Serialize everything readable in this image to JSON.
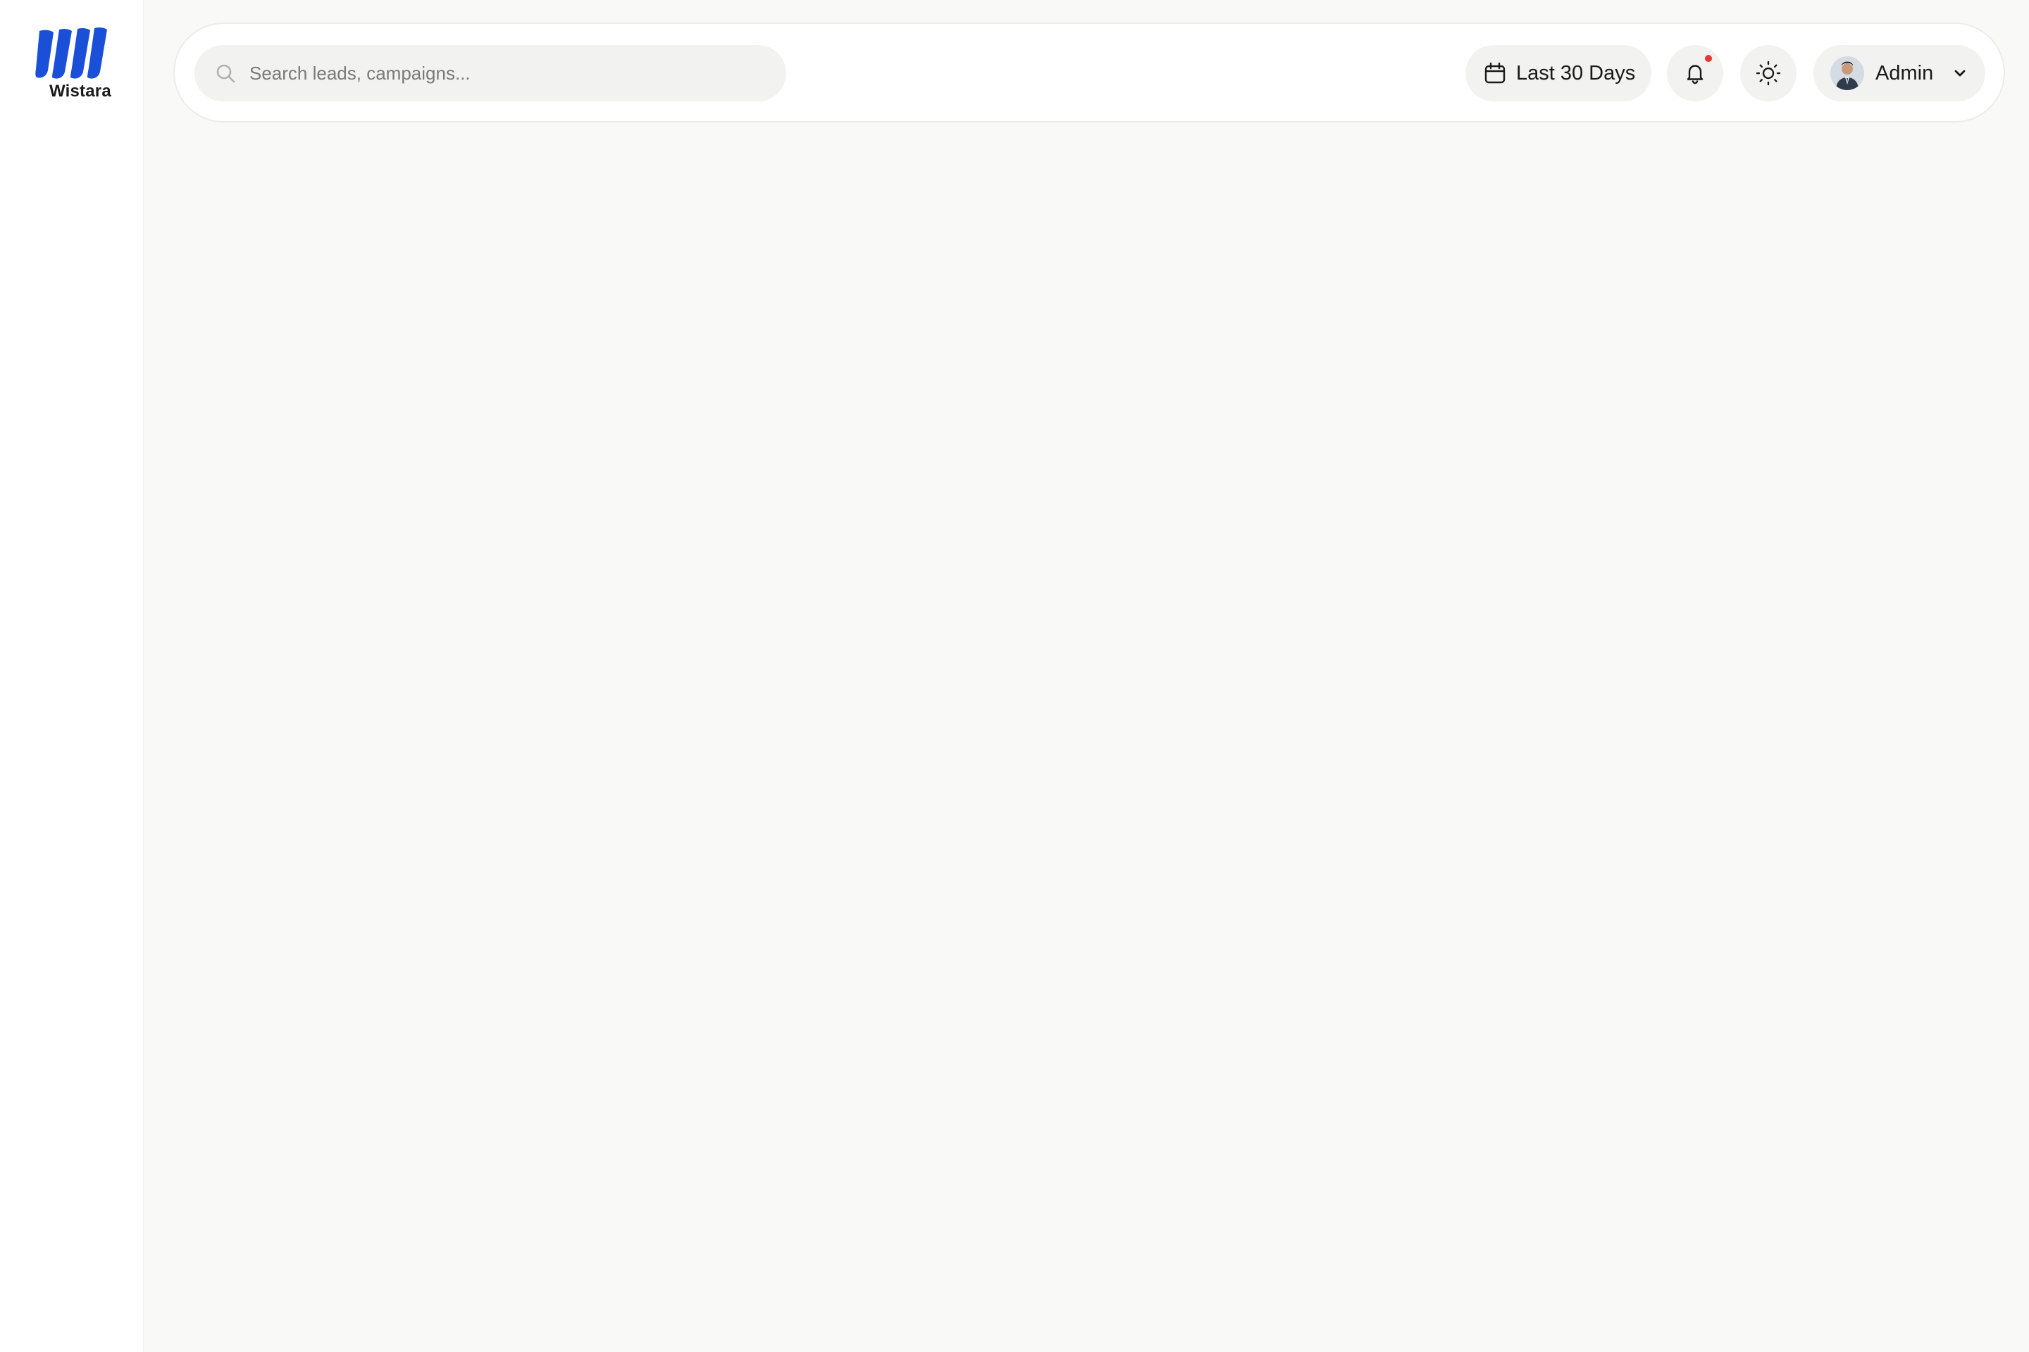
{
  "brand": {
    "name": "Wistara",
    "logo_icon": "wistara-logo-mark",
    "color": "#1a4fd8"
  },
  "header": {
    "search": {
      "placeholder": "Search leads, campaigns...",
      "value": "",
      "icon": "search-icon"
    },
    "date_range": {
      "label": "Last 30 Days",
      "icon": "calendar-icon"
    },
    "notifications": {
      "icon": "bell-icon",
      "has_unread": true,
      "dot_color": "#e53935"
    },
    "theme_toggle": {
      "icon": "sun-icon"
    },
    "user": {
      "name": "Admin",
      "icon": "chevron-down-icon"
    }
  }
}
